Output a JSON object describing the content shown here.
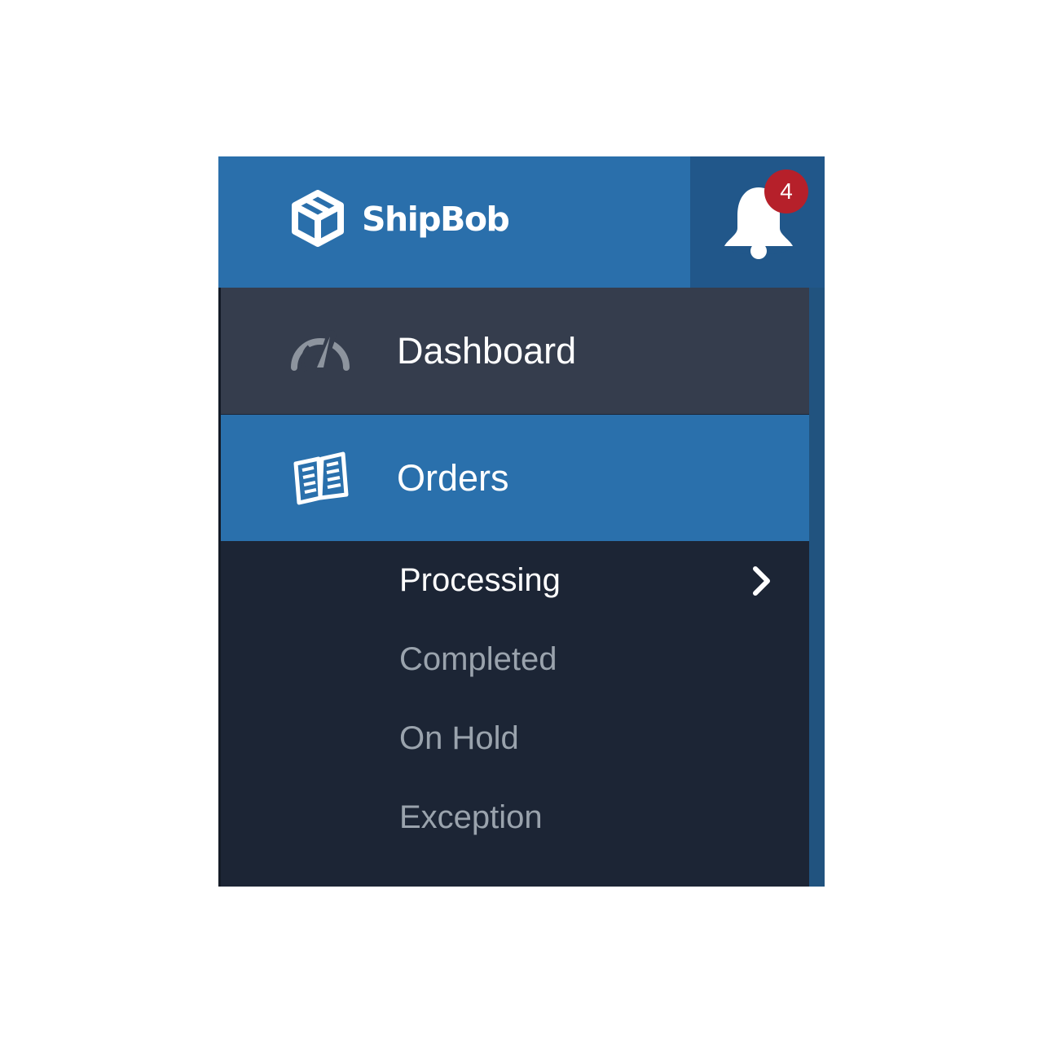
{
  "header": {
    "brand_name": "ShipBob",
    "brand_icon": "shipbob-box-logo-icon",
    "notifications": {
      "icon": "bell-icon",
      "count": "4"
    }
  },
  "nav": {
    "items": [
      {
        "label": "Dashboard",
        "icon": "speedometer-icon",
        "active": false
      },
      {
        "label": "Orders",
        "icon": "open-book-icon",
        "active": true
      }
    ]
  },
  "submenu": {
    "items": [
      {
        "label": "Processing",
        "active": true,
        "icon": "chevron-right-icon"
      },
      {
        "label": "Completed",
        "active": false
      },
      {
        "label": "On Hold",
        "active": false
      },
      {
        "label": "Exception",
        "active": false
      }
    ]
  },
  "colors": {
    "header_blue": "#2a6fab",
    "bell_box": "#21578a",
    "dashboard_bg": "#353d4d",
    "orders_active_bg": "#2a70ac",
    "submenu_bg": "#1c2535",
    "badge_red": "#b6202a",
    "submenu_text": "#9aa3ad"
  }
}
